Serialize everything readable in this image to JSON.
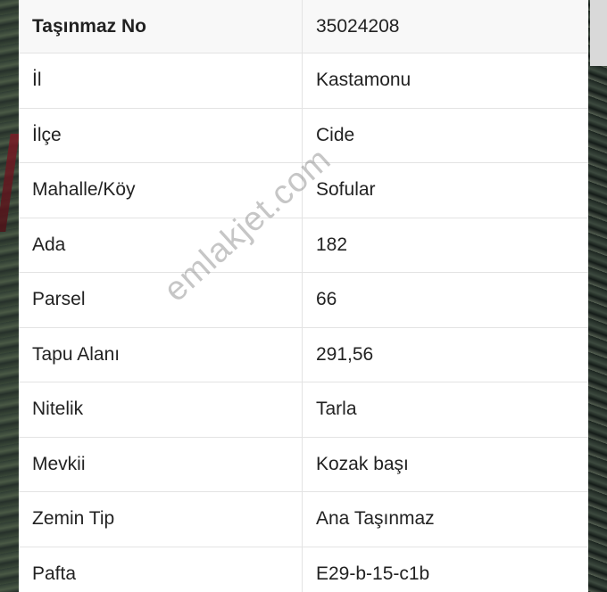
{
  "table": {
    "rows": [
      {
        "label": "Taşınmaz No",
        "value": "35024208"
      },
      {
        "label": "İl",
        "value": "Kastamonu"
      },
      {
        "label": "İlçe",
        "value": "Cide"
      },
      {
        "label": "Mahalle/Köy",
        "value": "Sofular"
      },
      {
        "label": "Ada",
        "value": "182"
      },
      {
        "label": "Parsel",
        "value": "66"
      },
      {
        "label": "Tapu Alanı",
        "value": "291,56"
      },
      {
        "label": "Nitelik",
        "value": "Tarla"
      },
      {
        "label": "Mevkii",
        "value": "Kozak başı"
      },
      {
        "label": "Zemin Tip",
        "value": "Ana Taşınmaz"
      },
      {
        "label": "Pafta",
        "value": "E29-b-15-c1b"
      }
    ]
  },
  "watermark": "emlakjet.com",
  "colors": {
    "header_row_bg": "#f8f8f8",
    "border": "#e3e3e3",
    "text": "#222222"
  }
}
